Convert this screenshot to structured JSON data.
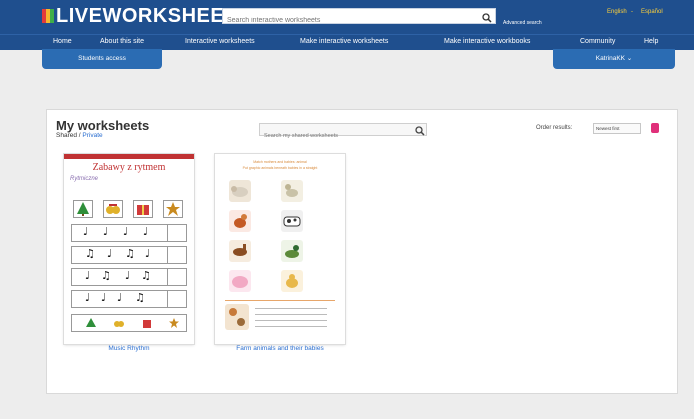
{
  "header": {
    "logo": "LIVEWORKSHEETS",
    "search_placeholder": "Search interactive worksheets",
    "advanced_search": "Advanced search",
    "lang_english": "English",
    "lang_sep": "-",
    "lang_spanish": "Español"
  },
  "nav": {
    "items": [
      "Home",
      "About this site",
      "Interactive worksheets",
      "Make interactive worksheets",
      "Make interactive workbooks",
      "Community",
      "Help"
    ]
  },
  "tabs": {
    "students": "Students access",
    "user": "KatrinaKK ⌄"
  },
  "main": {
    "title": "My worksheets",
    "shared": "Shared",
    "sep": " / ",
    "private": "Private",
    "search_placeholder": "Search my shared worksheets",
    "order_label": "Order results:",
    "order_value": "Newest first"
  },
  "worksheets": [
    {
      "caption": "Music Rhythm",
      "title": "Zabawy z rytmem",
      "sub": "Rytmiczne"
    },
    {
      "caption": "Farm animals and their babies",
      "heading1": "Match mothers and babies: animal",
      "heading2": "Put graphic animals beneath babies in a straight"
    }
  ],
  "colors": {
    "header_bg": "#1f4f8e",
    "tab_bg": "#2b6cb3",
    "link": "#2a6ed0",
    "accent_red": "#c03233",
    "order_go": "#e0307a"
  }
}
